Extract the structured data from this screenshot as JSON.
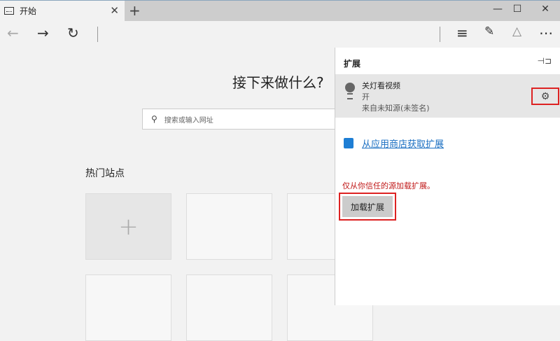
{
  "tab": {
    "title": "开始"
  },
  "panel": {
    "title": "扩展",
    "extension": {
      "name": "关灯看视频",
      "status": "开",
      "source": "来自未知源(未签名)"
    },
    "store_link": "从应用商店获取扩展",
    "warning": "仅从你信任的源加载扩展。",
    "load_button": "加载扩展"
  },
  "main": {
    "heading": "接下来做什么?",
    "search_placeholder": "搜索或输入网址",
    "top_sites": "热门站点"
  }
}
